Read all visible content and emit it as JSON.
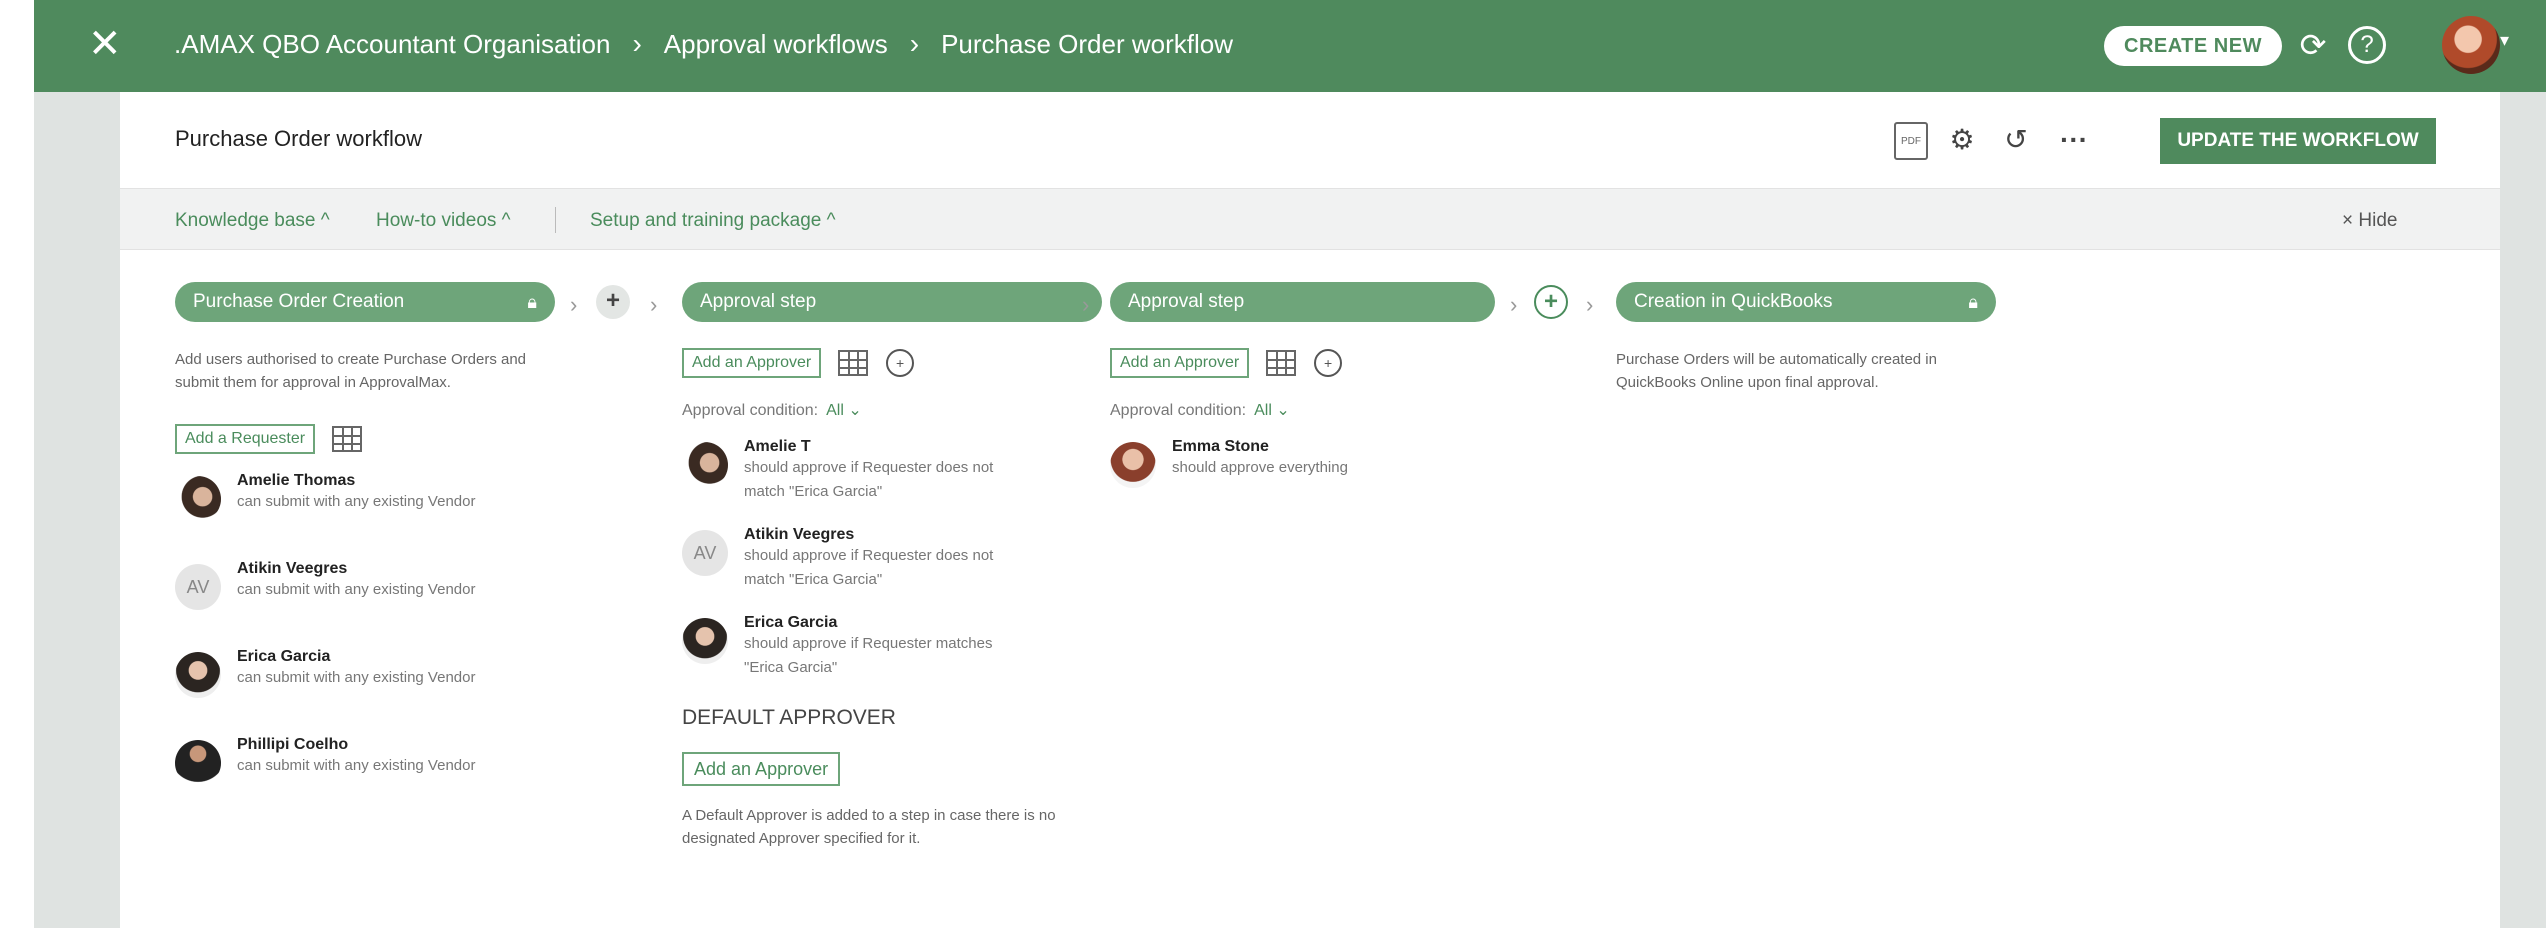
{
  "header": {
    "breadcrumbs": [
      ".AMAX QBO Accountant Organisation",
      "Approval workflows",
      "Purchase Order workflow"
    ],
    "create_new": "CREATE NEW"
  },
  "title": "Purchase Order workflow",
  "toolbar": {
    "update_label": "UPDATE THE WORKFLOW",
    "pdf_label": "PDF"
  },
  "kbbar": {
    "knowledge_base": "Knowledge base ^",
    "howto": "How-to videos ^",
    "setup": "Setup and training package ^",
    "hide": "× Hide"
  },
  "steps": {
    "creation": {
      "title": "Purchase Order Creation",
      "description": "Add users authorised to create Purchase Orders and submit them for approval in ApprovalMax.",
      "add_requester": "Add a Requester",
      "requesters": [
        {
          "name": "Amelie Thomas",
          "desc": "can submit with any existing Vendor"
        },
        {
          "name": "Atikin Veegres",
          "initials": "AV",
          "desc": "can submit with any existing Vendor"
        },
        {
          "name": "Erica Garcia",
          "desc": "can submit with any existing Vendor"
        },
        {
          "name": "Phillipi Coelho",
          "desc": "can submit with any existing Vendor"
        }
      ]
    },
    "approval1": {
      "title": "Approval step",
      "add_approver": "Add an Approver",
      "condition_label": "Approval condition:",
      "condition_value": "All ⌄",
      "approvers": [
        {
          "name": "Amelie T",
          "desc": "should approve if Requester does not match \"Erica Garcia\""
        },
        {
          "name": "Atikin Veegres",
          "initials": "AV",
          "desc": "should approve if Requester does not match \"Erica Garcia\""
        },
        {
          "name": "Erica Garcia",
          "desc": "should approve if Requester matches \"Erica Garcia\""
        }
      ],
      "default_heading": "DEFAULT APPROVER",
      "default_add": "Add an Approver",
      "default_desc": "A Default Approver is added to a step in case there is no designated Approver specified for it."
    },
    "approval2": {
      "title": "Approval step",
      "add_approver": "Add an Approver",
      "condition_label": "Approval condition:",
      "condition_value": "All ⌄",
      "approvers": [
        {
          "name": "Emma Stone",
          "desc": "should approve everything"
        }
      ]
    },
    "quickbooks": {
      "title": "Creation in QuickBooks",
      "description": "Purchase Orders will be automatically created in QuickBooks Online upon final approval."
    }
  }
}
